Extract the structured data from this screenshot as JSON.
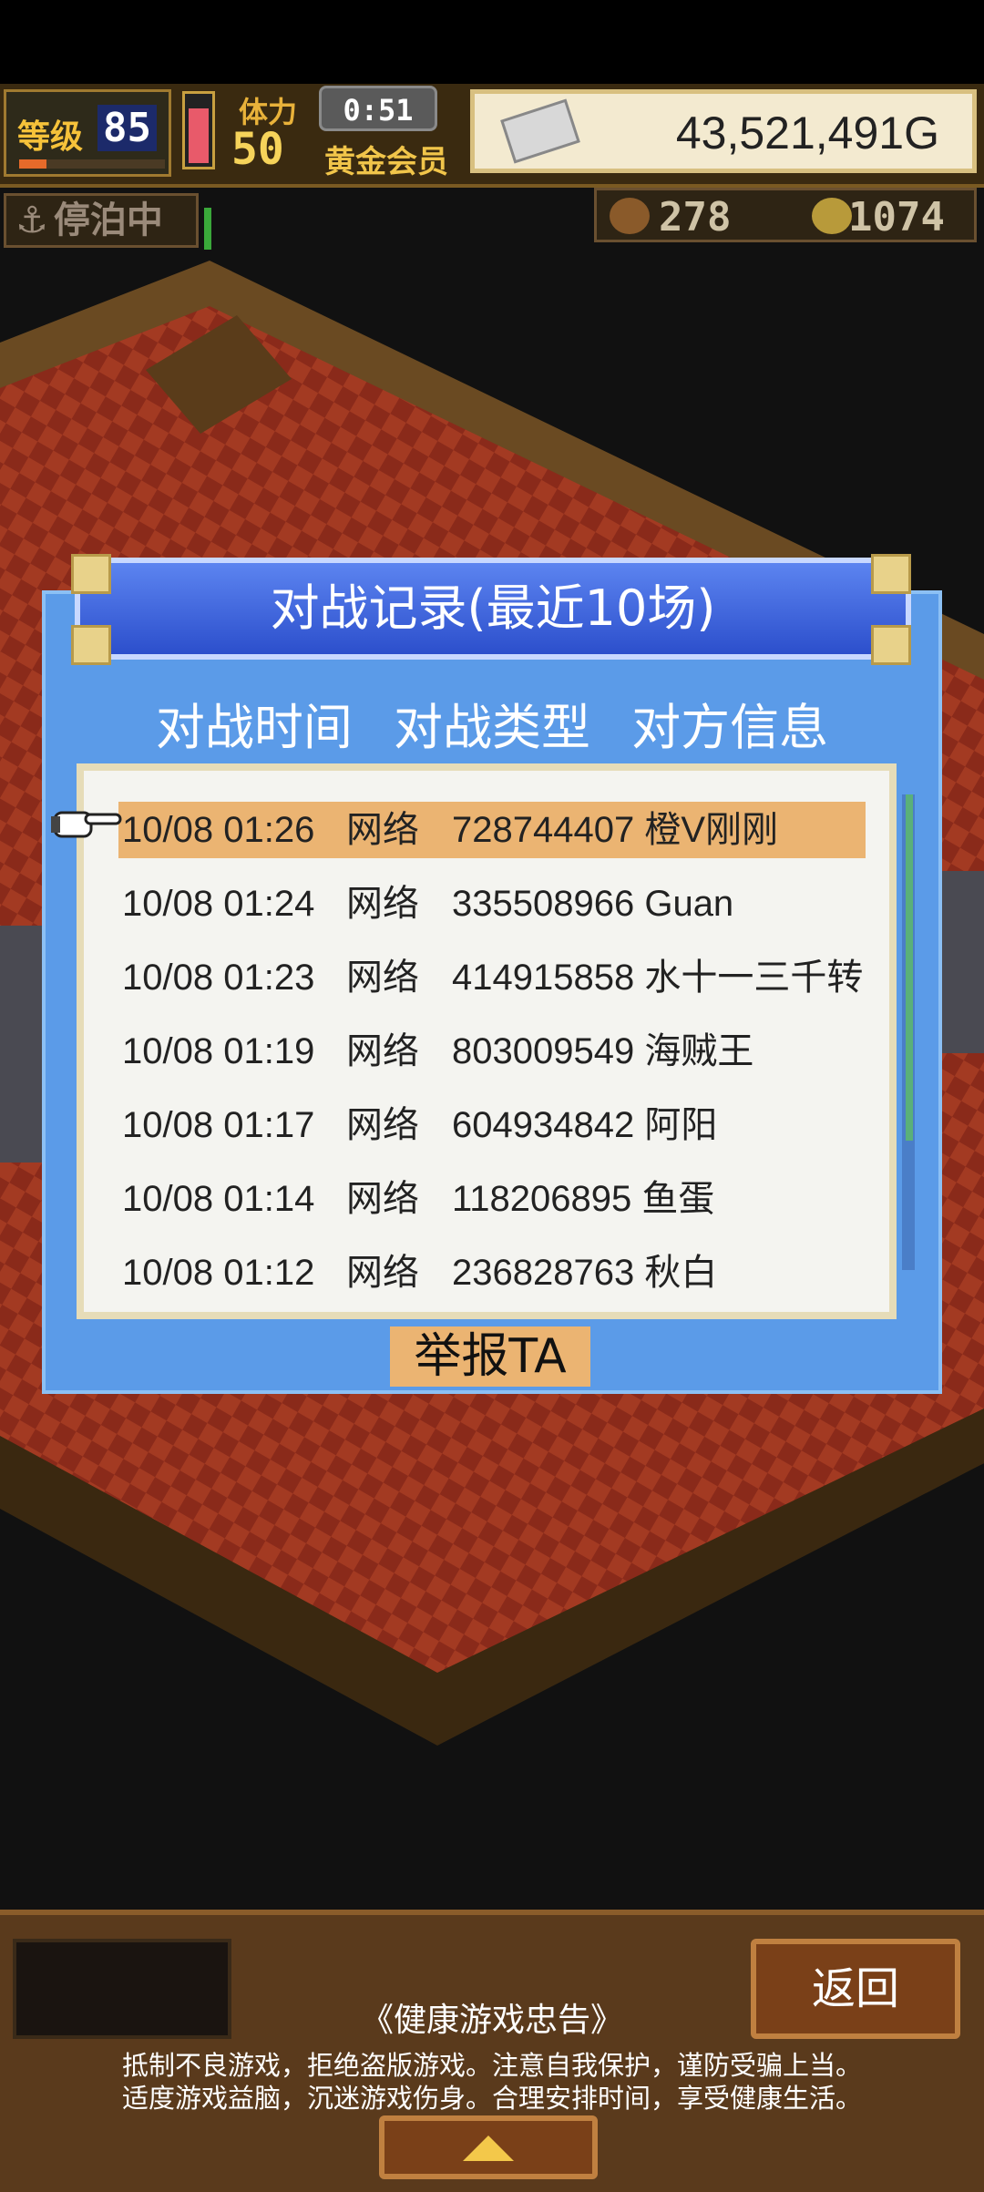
{
  "hud": {
    "level_label": "等级",
    "level_value": "85",
    "stamina_label": "体力",
    "stamina_value": "50",
    "timer": "0:51",
    "membership": "黄金会员",
    "gold": "43,521,491G",
    "dock_status": "停泊中",
    "resource_a": "278",
    "resource_b": "1074"
  },
  "dialog": {
    "title": "对战记录(最近10场)",
    "columns": [
      "对战时间",
      "对战类型",
      "对方信息"
    ],
    "rows": [
      {
        "time": "10/08 01:26",
        "type": "网络",
        "opponent": "728744407 橙V刚刚"
      },
      {
        "time": "10/08 01:24",
        "type": "网络",
        "opponent": "335508966 Guan"
      },
      {
        "time": "10/08 01:23",
        "type": "网络",
        "opponent": "414915858 水十一三千转"
      },
      {
        "time": "10/08 01:19",
        "type": "网络",
        "opponent": "803009549 海贼王"
      },
      {
        "time": "10/08 01:17",
        "type": "网络",
        "opponent": "604934842 阿阳"
      },
      {
        "time": "10/08 01:14",
        "type": "网络",
        "opponent": "118206895 鱼蛋"
      },
      {
        "time": "10/08 01:12",
        "type": "网络",
        "opponent": "236828763 秋白"
      }
    ],
    "report_button": "举报TA"
  },
  "bottom": {
    "back_button": "返回",
    "notice_title": "《健康游戏忠告》",
    "notice_line1": "抵制不良游戏，拒绝盗版游戏。注意自我保护，谨防受骗上当。",
    "notice_line2": "适度游戏益脑，沉迷游戏伤身。合理安排时间，享受健康生活。"
  },
  "colors": {
    "dialog_bg": "#5b9be8",
    "title_bg": "#2c4fcc",
    "selected_row": "#ebb472",
    "wood": "#5a3a1c"
  }
}
